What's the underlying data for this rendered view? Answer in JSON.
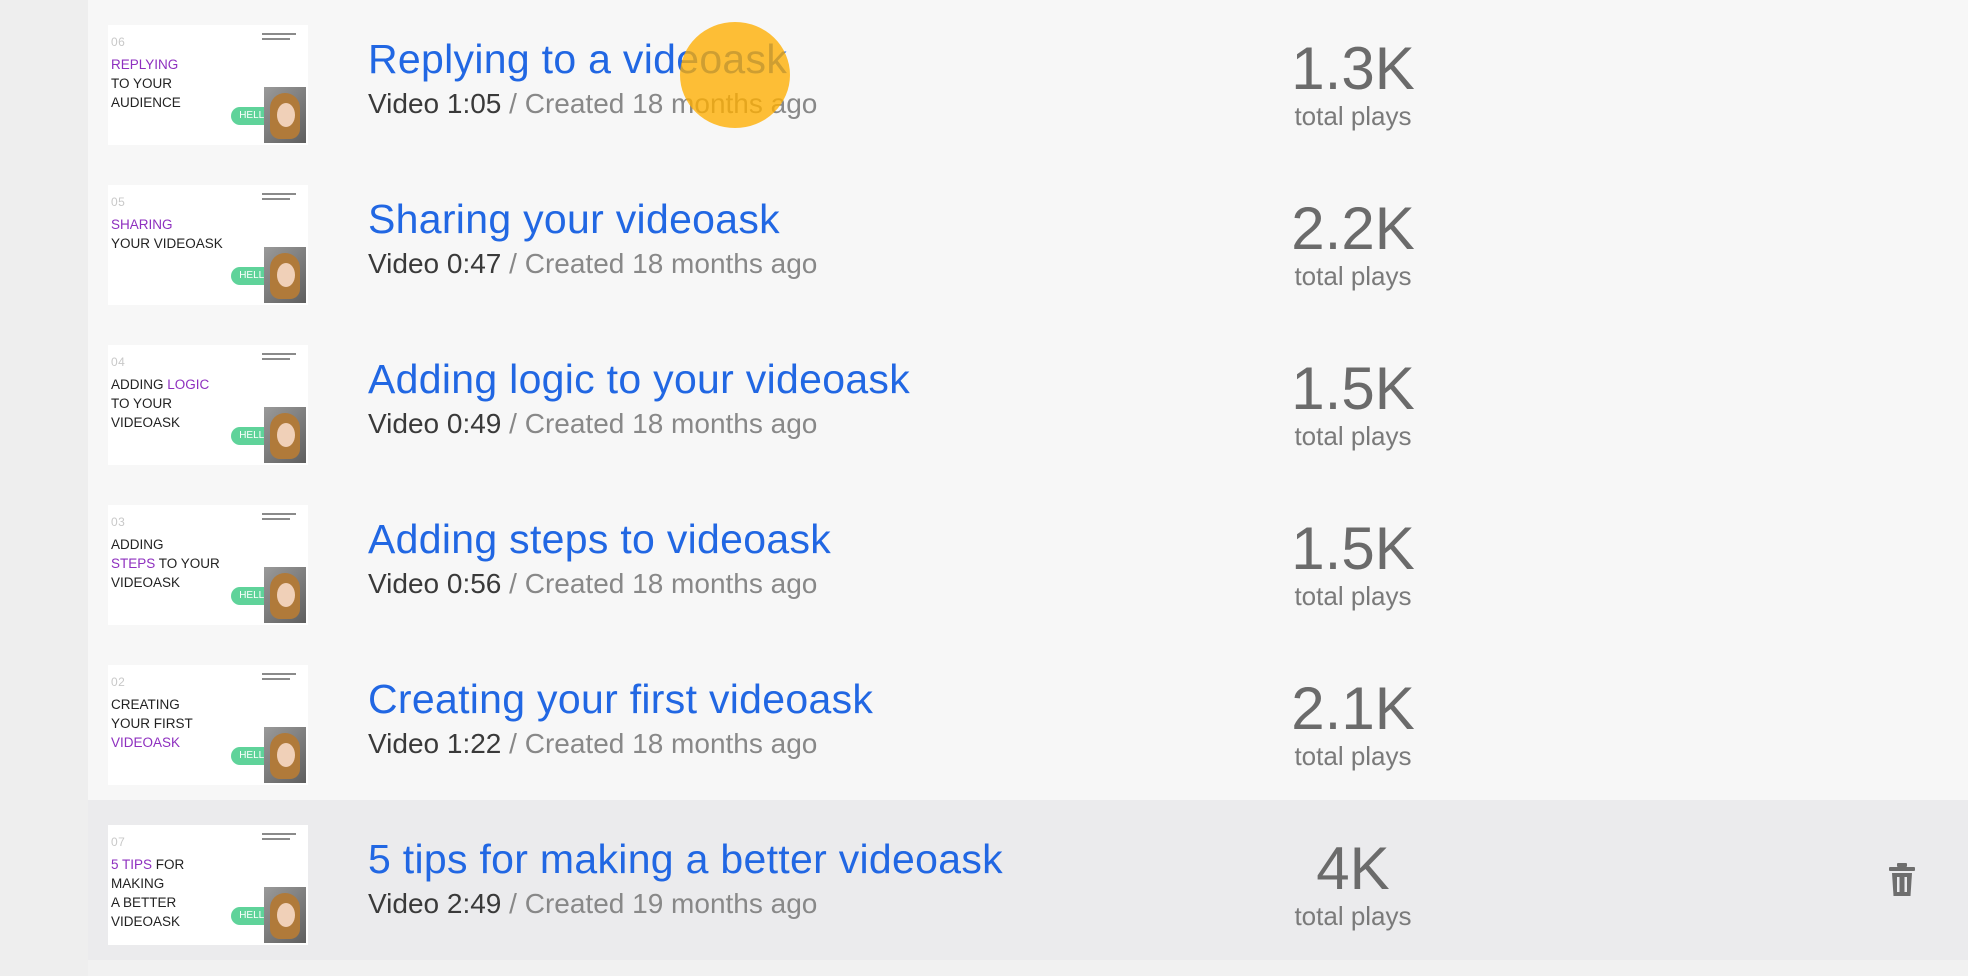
{
  "colors": {
    "title_blue": "#2167e3",
    "accent_purple": "#8e2fbf",
    "hello_green": "#5fd39a",
    "click_indicator": "#ffae00"
  },
  "videos": [
    {
      "title": "Replying to a videoask",
      "duration": "Video 1:05",
      "created": " / Created 18 months ago",
      "plays": "1.3K",
      "plays_label": "total plays",
      "thumb": {
        "num": "06",
        "lines": [
          [
            "REPLYING",
            ""
          ],
          [
            "",
            "TO YOUR"
          ],
          [
            "",
            "AUDIENCE"
          ]
        ],
        "hello": "HELLO"
      }
    },
    {
      "title": "Sharing your videoask",
      "duration": "Video 0:47",
      "created": " / Created 18 months ago",
      "plays": "2.2K",
      "plays_label": "total plays",
      "thumb": {
        "num": "05",
        "lines": [
          [
            "SHARING",
            ""
          ],
          [
            "",
            "YOUR VIDEOASK"
          ]
        ],
        "hello": "HELLO"
      }
    },
    {
      "title": "Adding logic to your videoask",
      "duration": "Video 0:49",
      "created": " / Created 18 months ago",
      "plays": "1.5K",
      "plays_label": "total plays",
      "thumb": {
        "num": "04",
        "lines": [
          [
            "",
            "ADDING "
          ],
          [
            "LOGIC",
            ""
          ],
          [
            "",
            "TO YOUR"
          ],
          [
            "",
            "VIDEOASK"
          ]
        ],
        "hello": "HELLO"
      }
    },
    {
      "title": "Adding steps to videoask",
      "duration": "Video 0:56",
      "created": " / Created 18 months ago",
      "plays": "1.5K",
      "plays_label": "total plays",
      "thumb": {
        "num": "03",
        "lines": [
          [
            "",
            "ADDING"
          ],
          [
            "STEPS",
            " TO YOUR"
          ],
          [
            "",
            "VIDEOASK"
          ]
        ],
        "hello": "HELLO"
      }
    },
    {
      "title": "Creating your first videoask",
      "duration": "Video 1:22",
      "created": " / Created 18 months ago",
      "plays": "2.1K",
      "plays_label": "total plays",
      "thumb": {
        "num": "02",
        "lines": [
          [
            "",
            "CREATING"
          ],
          [
            "",
            "YOUR FIRST"
          ],
          [
            "VIDEOASK",
            ""
          ]
        ],
        "hello": "HELLO"
      }
    },
    {
      "title": "5 tips for making a better videoask",
      "duration": "Video 2:49",
      "created": " / Created 19 months ago",
      "plays": "4K",
      "plays_label": "total plays",
      "thumb": {
        "num": "07",
        "lines": [
          [
            "5 TIPS",
            " FOR"
          ],
          [
            "",
            "MAKING"
          ],
          [
            "",
            "A BETTER"
          ],
          [
            "",
            "VIDEOASK"
          ]
        ],
        "hello": "HELLO"
      }
    }
  ],
  "icons": {
    "delete": "trash-icon"
  }
}
